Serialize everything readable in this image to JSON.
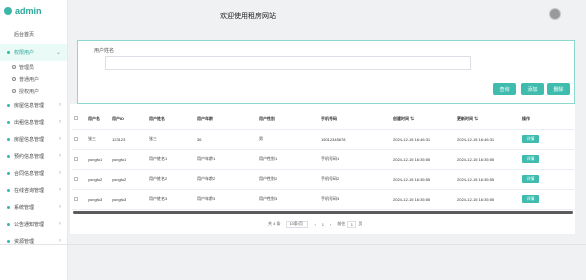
{
  "app": {
    "logo_text": "admin"
  },
  "header": {
    "title": "欢迎使用租房网站"
  },
  "sidebar": {
    "home": "后台首页",
    "groups": [
      {
        "label": "权限用户",
        "expanded": true,
        "children": [
          "管理员",
          "普通用户",
          "授权用户"
        ]
      },
      {
        "label": "房屋信息管理"
      },
      {
        "label": "出租信息管理"
      },
      {
        "label": "房屋信息管理"
      },
      {
        "label": "预约信息管理"
      },
      {
        "label": "合同信息管理"
      },
      {
        "label": "在线咨询管理"
      },
      {
        "label": "系统管理"
      },
      {
        "label": "公告通知管理"
      },
      {
        "label": "资源管理"
      }
    ]
  },
  "search": {
    "label": "用户姓名",
    "value": "",
    "placeholder": "",
    "buttons": {
      "query": "查询",
      "add": "添加",
      "delete": "删除"
    }
  },
  "table": {
    "columns": [
      "",
      "用户名",
      "用户ID",
      "用户姓名",
      "用户年龄",
      "用户性别",
      "手机号码",
      "创建时间",
      "更新时间",
      "操作"
    ],
    "rows": [
      [
        "",
        "张三",
        "123123",
        "张三",
        "36",
        "男",
        "15012345678",
        "2024-12-15 16:46:31",
        "2024-12-15 16:46:31",
        "详情"
      ],
      [
        "",
        "yongfu1",
        "yongfu1",
        "用户姓名1",
        "用户年龄1",
        "用户性别1",
        "手机号码1",
        "2024-12-15 16:35:55",
        "2024-12-15 16:35:55",
        "详情"
      ],
      [
        "",
        "yongfu2",
        "yongfu2",
        "用户姓名2",
        "用户年龄2",
        "用户性别2",
        "手机号码2",
        "2024-12-15 16:35:55",
        "2024-12-15 16:35:55",
        "详情"
      ],
      [
        "",
        "yongfu3",
        "yongfu3",
        "用户姓名3",
        "用户年龄3",
        "用户性别3",
        "手机号码3",
        "2024-12-15 16:35:55",
        "2024-12-15 16:35:55",
        "详情"
      ]
    ]
  },
  "pagination": {
    "total": "共 4 条",
    "page_size": "10条/页",
    "prev": "‹",
    "current": "1",
    "next": "›",
    "goto_label": "前往",
    "goto_value": "1",
    "goto_suffix": "页"
  },
  "colors": {
    "accent": "#3fbcae"
  }
}
